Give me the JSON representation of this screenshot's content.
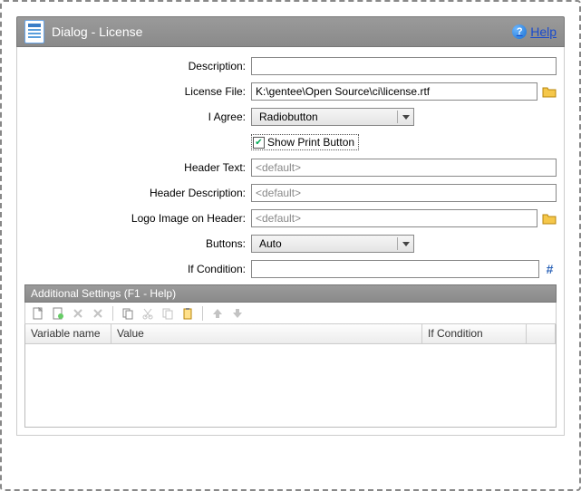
{
  "header": {
    "title": "Dialog - License",
    "help_label": "Help"
  },
  "form": {
    "description_label": "Description:",
    "description_value": "",
    "license_file_label": "License File:",
    "license_file_value": "K:\\gentee\\Open Source\\ci\\license.rtf",
    "iagree_label": "I Agree:",
    "iagree_value": "Radiobutton",
    "show_print_label": "Show Print Button",
    "show_print_checked": true,
    "header_text_label": "Header Text:",
    "header_text_placeholder": "<default>",
    "header_desc_label": "Header Description:",
    "header_desc_placeholder": "<default>",
    "logo_label": "Logo Image on Header:",
    "logo_placeholder": "<default>",
    "buttons_label": "Buttons:",
    "buttons_value": "Auto",
    "ifcond_label": "If Condition:",
    "ifcond_value": ""
  },
  "section": {
    "title": "Additional Settings (F1 - Help)"
  },
  "grid": {
    "col1": "Variable name",
    "col2": "Value",
    "col3": "If Condition",
    "col4": ""
  }
}
